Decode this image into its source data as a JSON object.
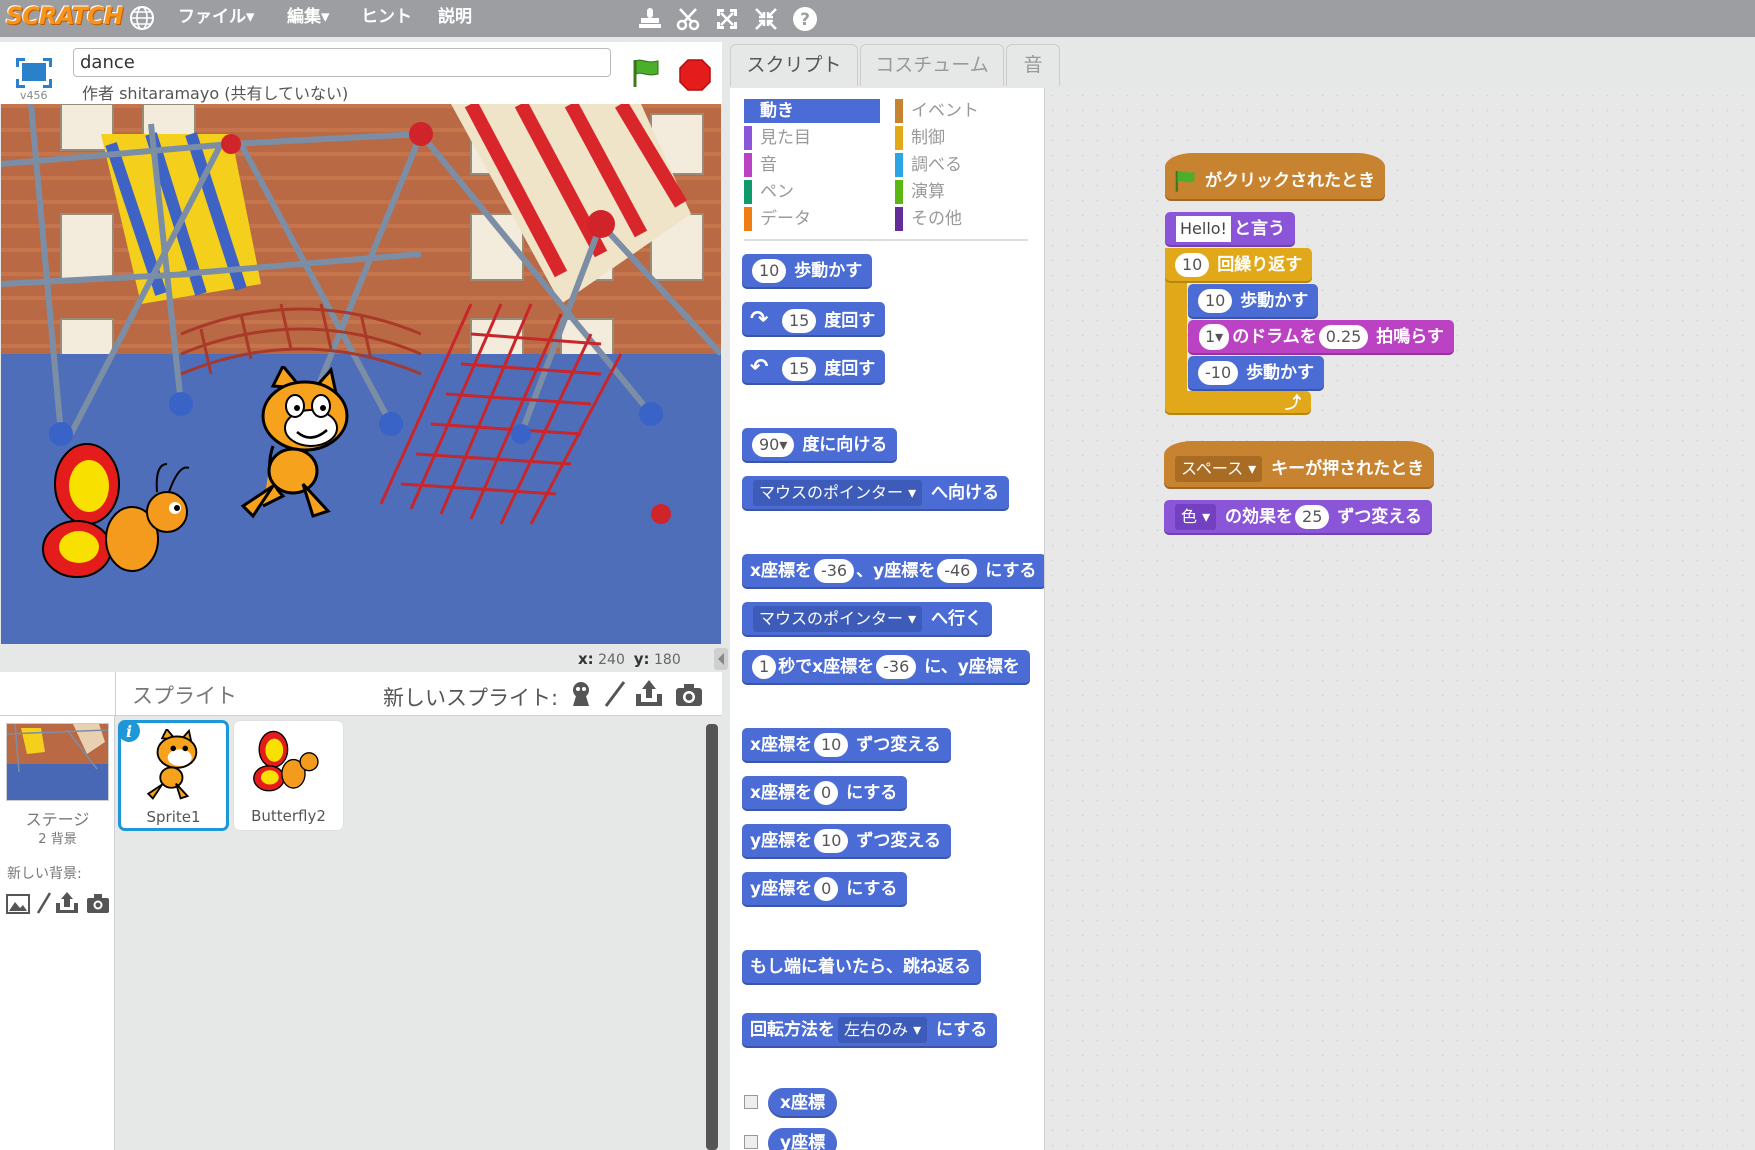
{
  "menubar": {
    "logo": "SCRATCH",
    "file": "ファイル▾",
    "edit": "編集▾",
    "hint": "ヒント",
    "about": "説明"
  },
  "project": {
    "name": "dance",
    "author": "作者 shitaramayo (共有していない)",
    "version": "v456"
  },
  "coords": {
    "x_label": "x:",
    "x": "240",
    "y_label": "y:",
    "y": "180"
  },
  "sprites": {
    "title": "スプライト",
    "new_sprite": "新しいスプライト:",
    "stage_label": "ステージ",
    "stage_bg": "2 背景",
    "new_bg": "新しい背景:",
    "items": [
      {
        "name": "Sprite1"
      },
      {
        "name": "Butterfly2"
      }
    ]
  },
  "tabs": [
    "スクリプト",
    "コスチューム",
    "音"
  ],
  "categories": [
    {
      "label": "動き",
      "color": "#4a6cd4"
    },
    {
      "label": "イベント",
      "color": "#c88330"
    },
    {
      "label": "見た目",
      "color": "#8a55d7"
    },
    {
      "label": "制御",
      "color": "#e1a91a"
    },
    {
      "label": "音",
      "color": "#bb42c3"
    },
    {
      "label": "調べる",
      "color": "#2ca5e2"
    },
    {
      "label": "ペン",
      "color": "#0e9a6c"
    },
    {
      "label": "演算",
      "color": "#5cb712"
    },
    {
      "label": "データ",
      "color": "#ee7d16"
    },
    {
      "label": "その他",
      "color": "#632d99"
    }
  ],
  "palette": {
    "move": {
      "v": "10",
      "t": "歩動かす"
    },
    "turn_r": {
      "v": "15",
      "t": "度回す"
    },
    "turn_l": {
      "v": "15",
      "t": "度回す"
    },
    "point_dir": {
      "v": "90▾",
      "t": "度に向ける"
    },
    "point_to": {
      "d": "マウスのポインター ▾",
      "t": "へ向ける"
    },
    "goto_xy": {
      "a": "x座標を",
      "x": "-36",
      "b": "、y座標を",
      "y": "-46",
      "c": "にする"
    },
    "goto": {
      "d": "マウスのポインター ▾",
      "t": "へ行く"
    },
    "glide": {
      "v": "1",
      "a": "秒でx座標を",
      "x": "-36",
      "b": "に、y座標を"
    },
    "change_x": {
      "a": "x座標を",
      "v": "10",
      "t": "ずつ変える"
    },
    "set_x": {
      "a": "x座標を",
      "v": "0",
      "t": "にする"
    },
    "change_y": {
      "a": "y座標を",
      "v": "10",
      "t": "ずつ変える"
    },
    "set_y": {
      "a": "y座標を",
      "v": "0",
      "t": "にする"
    },
    "bounce": "もし端に着いたら、跳ね返る",
    "rot_style": {
      "a": "回転方法を",
      "d": "左右のみ ▾",
      "t": "にする"
    },
    "xpos": "x座標",
    "ypos": "y座標"
  },
  "scripts": {
    "hat1": "がクリックされたとき",
    "say": {
      "v": "Hello!",
      "t": "と言う"
    },
    "repeat": {
      "v": "10",
      "t": "回繰り返す"
    },
    "move1": {
      "v": "10",
      "t": "歩動かす"
    },
    "drum": {
      "d": "1▾",
      "a": "のドラムを",
      "v": "0.25",
      "t": "拍鳴らす"
    },
    "move2": {
      "v": "-10",
      "t": "歩動かす"
    },
    "hat2": {
      "d": "スペース ▾",
      "t": "キーが押されたとき"
    },
    "effect": {
      "d": "色 ▾",
      "a": "の効果を",
      "v": "25",
      "t": "ずつ変える"
    }
  }
}
